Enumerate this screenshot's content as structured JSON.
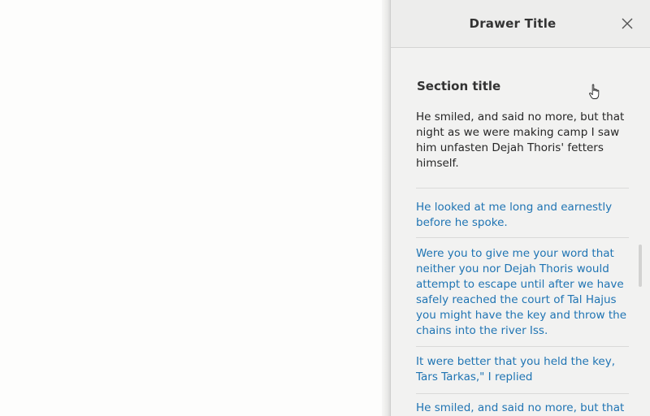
{
  "drawer": {
    "title": "Drawer Title",
    "section_title": "Section title",
    "intro": "He smiled, and said no more, but that night as we were making camp I saw him unfasten Dejah Thoris' fetters himself.",
    "items": [
      {
        "text": "He looked at me long and earnestly before he spoke."
      },
      {
        "text": "Were you to give me your word that neither you nor Dejah Thoris would attempt to escape until after we have safely reached the court of Tal Hajus you might have the key and throw the chains into the river Iss."
      },
      {
        "text": "It were better that you held the key, Tars Tarkas,\" I replied"
      },
      {
        "text": "He smiled, and said no more, but that"
      }
    ]
  },
  "icons": {
    "close": "close-icon",
    "cursor": "hand-pointer-icon"
  },
  "colors": {
    "link": "#1f74b3",
    "text": "#262626",
    "drawer_bg": "#f2f2f1",
    "header_bg": "#ededec"
  }
}
